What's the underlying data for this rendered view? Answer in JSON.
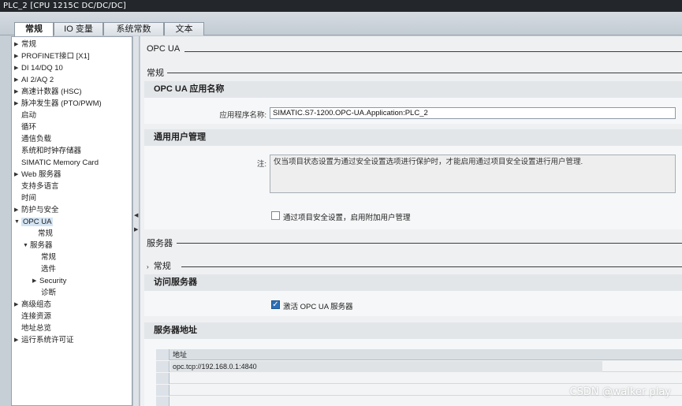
{
  "window": {
    "title": "PLC_2 [CPU 1215C DC/DC/DC]"
  },
  "tabs": [
    {
      "label": "常规",
      "active": true
    },
    {
      "label": "IO 变量",
      "active": false
    },
    {
      "label": "系统常数",
      "active": false
    },
    {
      "label": "文本",
      "active": false
    }
  ],
  "tree": [
    {
      "label": "常规",
      "arrow": "right"
    },
    {
      "label": "PROFINET接口 [X1]",
      "arrow": "right"
    },
    {
      "label": "DI 14/DQ 10",
      "arrow": "right"
    },
    {
      "label": "AI 2/AQ 2",
      "arrow": "right"
    },
    {
      "label": "高速计数器 (HSC)",
      "arrow": "right"
    },
    {
      "label": "脉冲发生器 (PTO/PWM)",
      "arrow": "right"
    },
    {
      "label": "启动",
      "arrow": ""
    },
    {
      "label": "循环",
      "arrow": ""
    },
    {
      "label": "通信负载",
      "arrow": ""
    },
    {
      "label": "系统和时钟存储器",
      "arrow": ""
    },
    {
      "label": "SIMATIC Memory Card",
      "arrow": ""
    },
    {
      "label": "Web 服务器",
      "arrow": "right"
    },
    {
      "label": "支持多语言",
      "arrow": ""
    },
    {
      "label": "时间",
      "arrow": ""
    },
    {
      "label": "防护与安全",
      "arrow": "right"
    },
    {
      "label": "OPC UA",
      "arrow": "down",
      "selected": true
    },
    {
      "label": "常规",
      "arrow": "",
      "level": 1
    },
    {
      "label": "服务器",
      "arrow": "down",
      "level": 1
    },
    {
      "label": "常规",
      "arrow": "",
      "level": 2
    },
    {
      "label": "选件",
      "arrow": "",
      "level": 2
    },
    {
      "label": "Security",
      "arrow": "right",
      "level": 2
    },
    {
      "label": "诊断",
      "arrow": "",
      "level": 2
    },
    {
      "label": "高级组态",
      "arrow": "right"
    },
    {
      "label": "连接资源",
      "arrow": ""
    },
    {
      "label": "地址总览",
      "arrow": ""
    },
    {
      "label": "运行系统许可证",
      "arrow": "right"
    }
  ],
  "content": {
    "section_title": "OPC UA",
    "sub_general": "常规",
    "app_name_group": {
      "title": "OPC UA 应用名称",
      "field_label": "应用程序名称:",
      "field_value": "SIMATIC.S7-1200.OPC-UA.Application:PLC_2"
    },
    "user_mgmt_group": {
      "title": "通用用户管理",
      "note_label": "注:",
      "note_text": "仅当项目状态设置为通过安全设置选项进行保护时，才能启用通过项目安全设置进行用户管理.",
      "checkbox_label": "通过项目安全设置，启用附加用户管理",
      "checkbox_checked": false
    },
    "server_title": "服务器",
    "server_general_title": "常规",
    "access_group": {
      "title": "访问服务器",
      "checkbox_label": "激活 OPC UA 服务器",
      "checkbox_checked": true
    },
    "address_group": {
      "title": "服务器地址",
      "column_header": "地址",
      "rows": [
        "opc.tcp://192.168.0.1:4840"
      ]
    }
  },
  "watermark": "CSDN @walker play"
}
